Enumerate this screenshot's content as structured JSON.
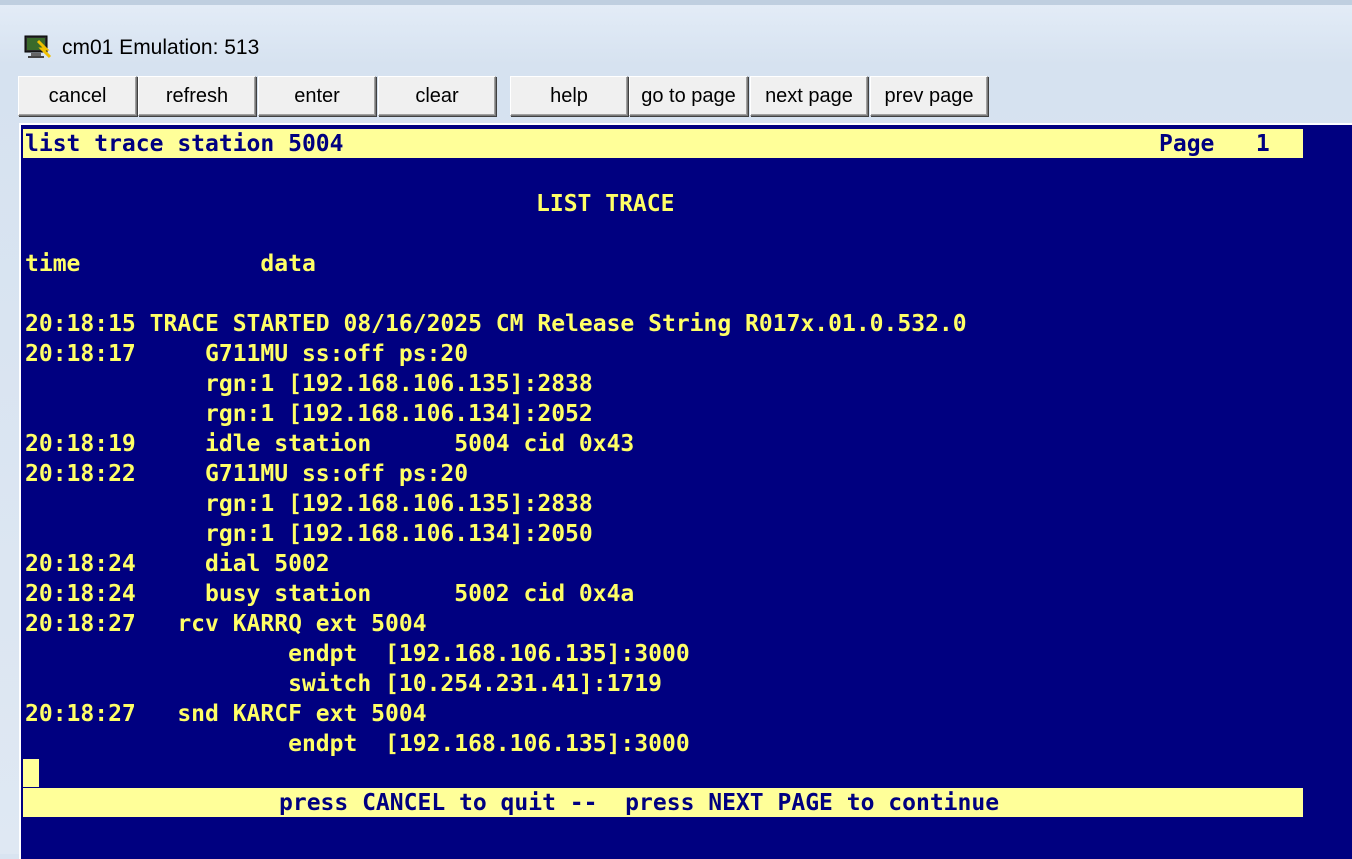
{
  "window": {
    "title": "cm01 Emulation: 513",
    "icon": "terminal-emulator-icon"
  },
  "toolbar": {
    "buttons": [
      {
        "label": "cancel"
      },
      {
        "label": "refresh"
      },
      {
        "label": "enter"
      },
      {
        "label": "clear"
      },
      {
        "label": "help"
      },
      {
        "label": "go to page"
      },
      {
        "label": "next page"
      },
      {
        "label": "prev page"
      }
    ]
  },
  "terminal": {
    "colors": {
      "background": "#000080",
      "text": "#ffff66",
      "bar": "#ffff99",
      "bar_text": "#000080"
    },
    "command": "list trace station 5004",
    "page_label": "Page   1",
    "heading": "LIST TRACE",
    "columns": "time             data",
    "lines": [
      "20:18:15 TRACE STARTED 08/16/2025 CM Release String R017x.01.0.532.0",
      "20:18:17     G711MU ss:off ps:20",
      "             rgn:1 [192.168.106.135]:2838",
      "             rgn:1 [192.168.106.134]:2052",
      "20:18:19     idle station      5004 cid 0x43",
      "20:18:22     G711MU ss:off ps:20",
      "             rgn:1 [192.168.106.135]:2838",
      "             rgn:1 [192.168.106.134]:2050",
      "20:18:24     dial 5002",
      "20:18:24     busy station      5002 cid 0x4a",
      "20:18:27   rcv KARRQ ext 5004",
      "                   endpt  [192.168.106.135]:3000",
      "                   switch [10.254.231.41]:1719",
      "20:18:27   snd KARCF ext 5004",
      "                   endpt  [192.168.106.135]:3000"
    ],
    "footer": "press CANCEL to quit --  press NEXT PAGE to continue"
  }
}
